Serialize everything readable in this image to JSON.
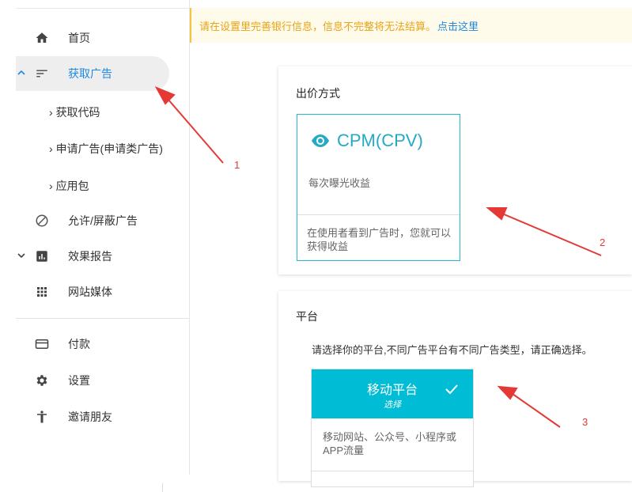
{
  "warning": {
    "text": "请在设置里完善银行信息，信息不完整将无法结算。",
    "link": "点击这里"
  },
  "sidebar": {
    "items": [
      {
        "label": "首页",
        "icon": "home-icon"
      },
      {
        "label": "获取广告",
        "icon": "sort-lines-icon",
        "caret": "^",
        "active": true
      },
      {
        "label": "允许/屏蔽广告",
        "icon": "block-icon"
      },
      {
        "label": "效果报告",
        "icon": "bar-chart-icon",
        "caret": "v"
      },
      {
        "label": "网站媒体",
        "icon": "grid-icon"
      },
      {
        "label": "付款",
        "icon": "credit-card-icon"
      },
      {
        "label": "设置",
        "icon": "gear-icon"
      },
      {
        "label": "邀请朋友",
        "icon": "person-icon"
      }
    ],
    "subitems": [
      "获取代码",
      "申请广告(申请类广告)",
      "应用包"
    ]
  },
  "bidding": {
    "title": "出价方式",
    "cpm_title": "CPM(CPV)",
    "cpm_desc": "每次曝光收益",
    "cpm_foot": "在使用者看到广告时，您就可以获得收益"
  },
  "platform": {
    "title": "平台",
    "intro": "请选择你的平台,不同广告平台有不同广告类型，请正确选择。",
    "mobile_name": "移动平台",
    "mobile_sub": "选择",
    "mobile_desc": "移动网站、公众号、小程序或APP流量"
  },
  "annotations": [
    "1",
    "2",
    "3"
  ],
  "colors": {
    "accent": "#1e88e5",
    "teal": "#00bcd4",
    "warn_text": "#e8a317",
    "annotation": "#e53935"
  }
}
